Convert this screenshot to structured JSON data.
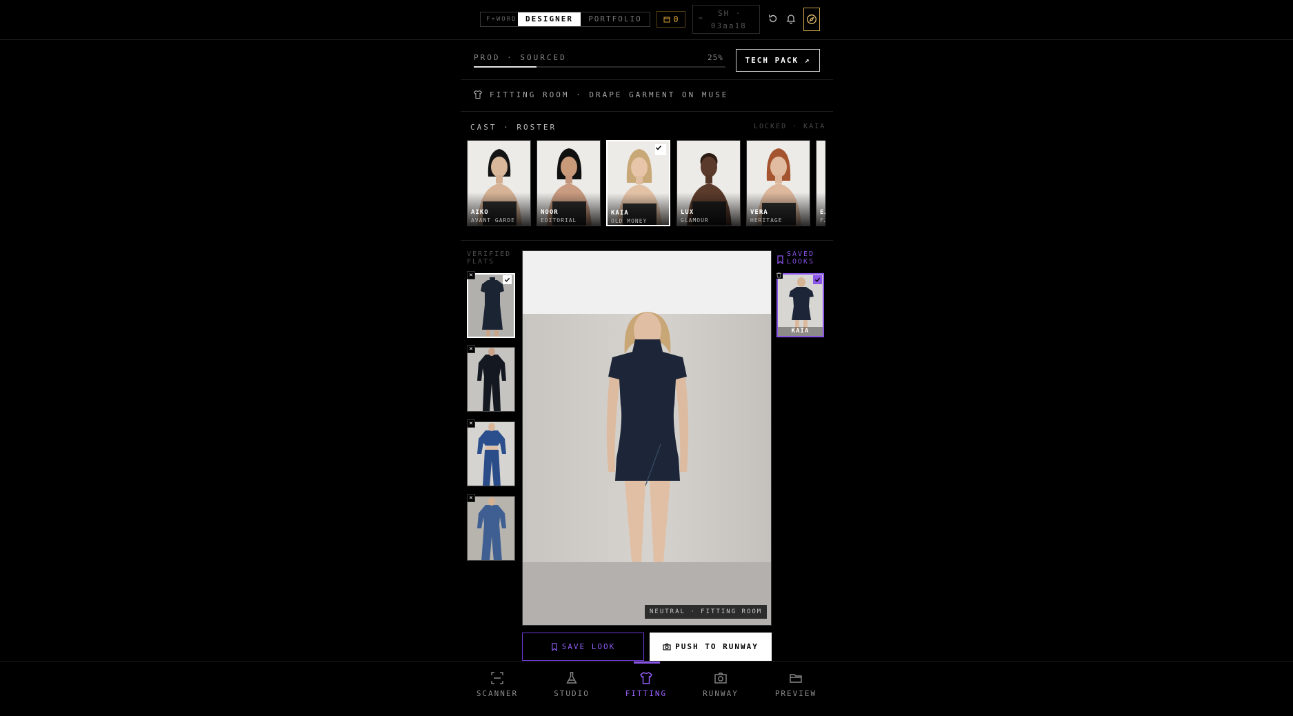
{
  "header": {
    "brand": "F∗WORD",
    "mode_active": "DESIGNER",
    "mode_other": "PORTFOLIO",
    "credits": "0",
    "session_prefix": "SH ·",
    "session_id": "03aa18",
    "icons": [
      "refresh-icon",
      "bell-icon",
      "compass-icon"
    ]
  },
  "progress": {
    "label": "PROD · SOURCED",
    "percent_label": "25%",
    "percent": 25,
    "tech_pack": "TECH PACK ↗"
  },
  "fitting": {
    "title": "FITTING ROOM · DRAPE GARMENT ON MUSE"
  },
  "cast": {
    "label": "CAST · ROSTER",
    "status": "LOCKED · KAIA",
    "muses": [
      {
        "name": "AIKO",
        "type": "AVANT GARDE",
        "selected": false
      },
      {
        "name": "NOOR",
        "type": "EDITORIAL",
        "selected": false
      },
      {
        "name": "KAIA",
        "type": "OLD MONEY",
        "selected": true
      },
      {
        "name": "LUX",
        "type": "GLAMOUR",
        "selected": false
      },
      {
        "name": "VERA",
        "type": "HERITAGE",
        "selected": false
      },
      {
        "name": "E…",
        "type": "F…",
        "selected": false
      }
    ]
  },
  "flats": {
    "label": "VERIFIED FLATS",
    "items": [
      {
        "garment": "navy mini dress",
        "selected": true
      },
      {
        "garment": "black jumpsuit",
        "selected": false
      },
      {
        "garment": "blue two-piece",
        "selected": false
      },
      {
        "garment": "denim jumpsuit",
        "selected": false
      }
    ]
  },
  "stage": {
    "tag": "NEUTRAL · FITTING ROOM"
  },
  "saved": {
    "label": "SAVED LOOKS",
    "looks": [
      {
        "name": "KAIA",
        "selected": true
      }
    ]
  },
  "actions": {
    "save": "SAVE LOOK",
    "push": "PUSH TO RUNWAY"
  },
  "nav": {
    "items": [
      {
        "label": "SCANNER",
        "icon": "scan-icon"
      },
      {
        "label": "STUDIO",
        "icon": "flask-icon"
      },
      {
        "label": "FITTING",
        "icon": "shirt-icon",
        "active": true
      },
      {
        "label": "RUNWAY",
        "icon": "camera-icon"
      },
      {
        "label": "PREVIEW",
        "icon": "folder-icon"
      }
    ]
  },
  "colors": {
    "accent": "#8a55e8",
    "gold": "#d8a03c",
    "background": "#000000"
  }
}
